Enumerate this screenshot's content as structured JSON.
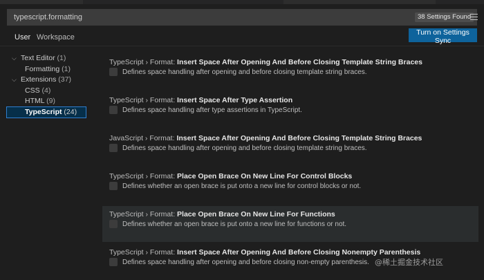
{
  "search": {
    "value": "typescript.formatting",
    "results_badge": "38 Settings Found",
    "filter_icon": "filter-list-icon"
  },
  "tabs": {
    "user": "User",
    "workspace": "Workspace"
  },
  "sync_button": "Turn on Settings Sync",
  "toc": [
    {
      "label": "Text Editor",
      "count": "(1)",
      "chevron": "⌵"
    },
    {
      "label": "Formatting",
      "count": "(1)",
      "chevron": ""
    },
    {
      "label": "Extensions",
      "count": "(37)",
      "chevron": "⌵"
    },
    {
      "label": "CSS",
      "count": "(4)",
      "chevron": ""
    },
    {
      "label": "HTML",
      "count": "(9)",
      "chevron": ""
    },
    {
      "label": "TypeScript",
      "count": "(24)",
      "chevron": ""
    }
  ],
  "settings": [
    {
      "category": "TypeScript › Format: ",
      "name": "Insert Space After Opening And Before Closing Template String Braces",
      "description": "Defines space handling after opening and before closing template string braces."
    },
    {
      "category": "TypeScript › Format: ",
      "name": "Insert Space After Type Assertion",
      "description": "Defines space handling after type assertions in TypeScript."
    },
    {
      "category": "JavaScript › Format: ",
      "name": "Insert Space After Opening And Before Closing Template String Braces",
      "description": "Defines space handling after opening and before closing template string braces."
    },
    {
      "category": "TypeScript › Format: ",
      "name": "Place Open Brace On New Line For Control Blocks",
      "description": "Defines whether an open brace is put onto a new line for control blocks or not."
    },
    {
      "category": "TypeScript › Format: ",
      "name": "Place Open Brace On New Line For Functions",
      "description": "Defines whether an open brace is put onto a new line for functions or not."
    },
    {
      "category": "TypeScript › Format: ",
      "name": "Insert Space After Opening And Before Closing Nonempty Parenthesis",
      "description": "Defines space handling after opening and before closing non-empty parenthesis."
    }
  ],
  "watermark": "@稀土掘金技术社区"
}
